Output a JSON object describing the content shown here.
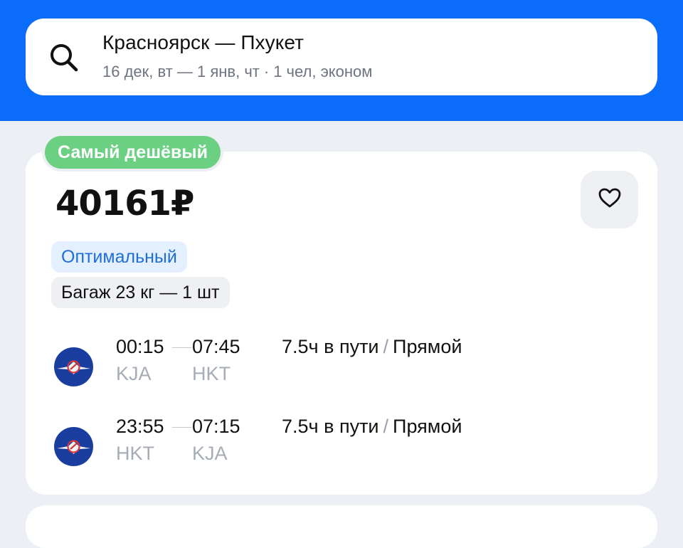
{
  "search": {
    "route": "Красноярск — Пхукет",
    "dates": "16 дек, вт — 1 янв, чт",
    "separator": "·",
    "passengers": "1 чел, эконом"
  },
  "offer": {
    "badge": "Самый дешёвый",
    "price": "40161₽",
    "tags": {
      "fare": "Оптимальный",
      "baggage": "Багаж 23 кг — 1 шт"
    },
    "flights": [
      {
        "dep_time": "00:15",
        "arr_time": "07:45",
        "dep_code": "KJA",
        "arr_code": "HKT",
        "duration": "7.5ч в пути",
        "divider": "/",
        "stops": "Прямой"
      },
      {
        "dep_time": "23:55",
        "arr_time": "07:15",
        "dep_code": "HKT",
        "arr_code": "KJA",
        "duration": "7.5ч в пути",
        "divider": "/",
        "stops": "Прямой"
      }
    ]
  },
  "colors": {
    "header": "#0b6cfa",
    "badge": "#6cd082",
    "fare_tag_text": "#1f6fd8",
    "airline_logo": "#1a3ea0"
  },
  "icons": {
    "search": "search-icon",
    "favorite": "heart-icon",
    "airline": "airline-logo-icon"
  }
}
